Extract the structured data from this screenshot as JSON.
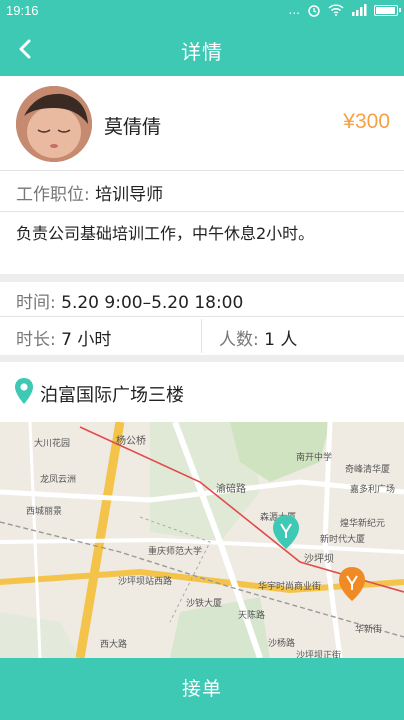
{
  "status_bar": {
    "time": "19:16",
    "signal_dots": "...",
    "icons": [
      "alarm-icon",
      "wifi-icon",
      "signal-icon",
      "battery-icon"
    ],
    "battery_level": 0.85
  },
  "nav": {
    "title": "详情",
    "back_icon": "back-arrow-icon"
  },
  "profile": {
    "name": "莫倩倩",
    "price": "¥300"
  },
  "job": {
    "position_label": "工作职位:",
    "position_value": "培训导师",
    "description": "负责公司基础培训工作，中午休息2小时。"
  },
  "schedule": {
    "time_label": "时间:",
    "time_value": "5.20 9:00–5.20 18:00",
    "duration_label": "时长:",
    "duration_value": "7 小时",
    "people_label": "人数:",
    "people_value": "1 人"
  },
  "location": {
    "address": "泊富国际广场三楼",
    "pin_icon": "location-pin-icon"
  },
  "map": {
    "labels": [
      "杨公桥",
      "大川花园",
      "龙凤云洲",
      "西城丽景",
      "渝碚路",
      "森源大厦",
      "南开中学",
      "奇峰清华厦",
      "嘉多利广场",
      "新时代大厦",
      "煌华新纪元",
      "重庆师范大学",
      "沙坪坝",
      "华宇时尚商业街",
      "沙坪坝站西路",
      "沙铁大厦",
      "天陈路",
      "西大路",
      "沙杨路",
      "华新街",
      "沙坪坝正街"
    ]
  },
  "action": {
    "accept_label": "接单"
  },
  "colors": {
    "accent": "#3dc9b4",
    "price": "#f5a243",
    "pin": "#3dc9b4"
  }
}
